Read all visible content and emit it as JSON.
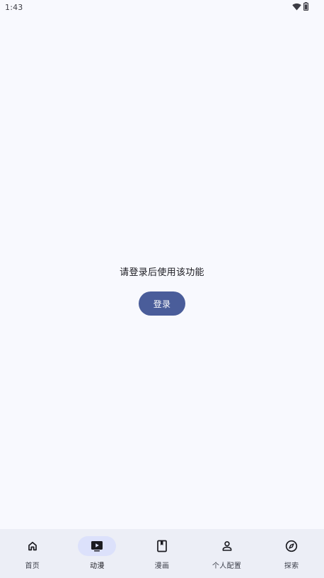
{
  "status_bar": {
    "time": "1:43",
    "icons": [
      "wifi-icon",
      "battery-icon"
    ]
  },
  "main": {
    "message": "请登录后使用该功能",
    "login_button_label": "登录",
    "accent_color": "#4a5d9a"
  },
  "bottom_nav": {
    "active_index": 1,
    "items": [
      {
        "label": "首页",
        "icon": "home-icon"
      },
      {
        "label": "动漫",
        "icon": "tv-play-icon"
      },
      {
        "label": "漫画",
        "icon": "book-icon"
      },
      {
        "label": "个人配置",
        "icon": "person-icon"
      },
      {
        "label": "探索",
        "icon": "compass-icon"
      }
    ]
  }
}
